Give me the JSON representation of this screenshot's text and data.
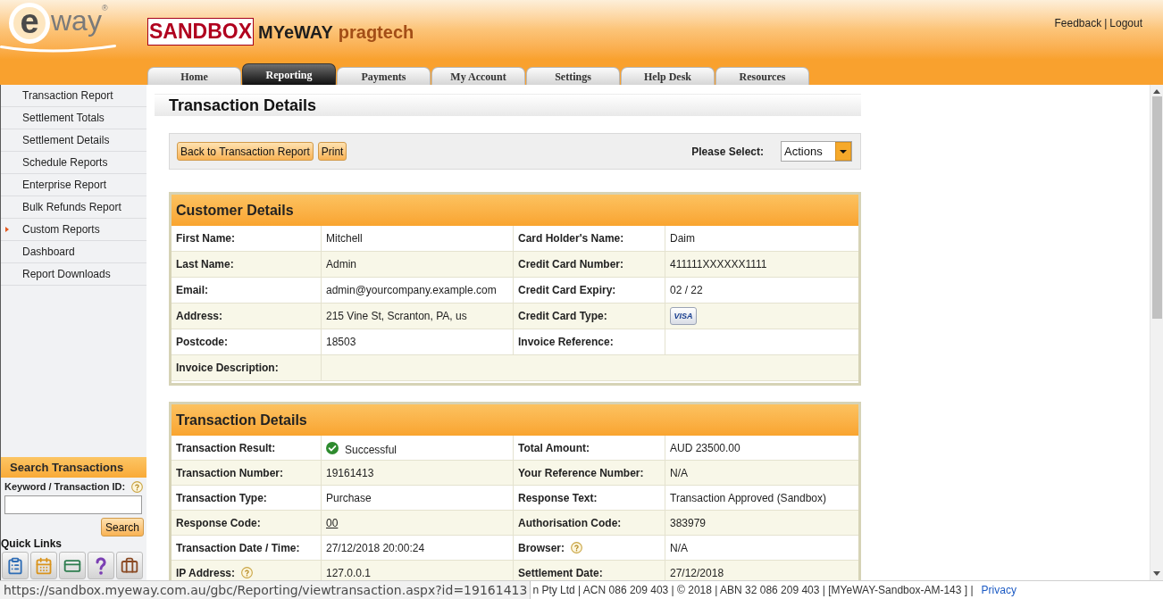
{
  "header": {
    "logo": {
      "mark": "e",
      "wordmark": "way$^{®}$"
    },
    "environment_badge": "SANDBOX",
    "app_name": "MYeWAY",
    "account_name": "pragtech",
    "links": [
      {
        "label": "Feedback"
      },
      {
        "label": "Logout"
      }
    ],
    "link_separator": "|"
  },
  "tabs": [
    {
      "label": "Home",
      "selected": false
    },
    {
      "label": "Reporting",
      "selected": true
    },
    {
      "label": "Payments",
      "selected": false
    },
    {
      "label": "My Account",
      "selected": false
    },
    {
      "label": "Settings",
      "selected": false
    },
    {
      "label": "Help Desk",
      "selected": false
    },
    {
      "label": "Resources",
      "selected": false
    }
  ],
  "sidebar": {
    "items": [
      {
        "label": "Transaction Report",
        "has_submenu": false
      },
      {
        "label": "Settlement Totals",
        "has_submenu": false
      },
      {
        "label": "Settlement Details",
        "has_submenu": false
      },
      {
        "label": "Schedule Reports",
        "has_submenu": false
      },
      {
        "label": "Enterprise Report",
        "has_submenu": false
      },
      {
        "label": "Bulk Refunds Report",
        "has_submenu": false
      },
      {
        "label": "Custom Reports",
        "has_submenu": true
      },
      {
        "label": "Dashboard",
        "has_submenu": false
      },
      {
        "label": "Report Downloads",
        "has_submenu": false
      }
    ],
    "search": {
      "title": "Search Transactions",
      "label": "Keyword / Transaction ID:",
      "button": "Search"
    },
    "quick_links": {
      "title": "Quick Links"
    }
  },
  "page": {
    "title": "Transaction Details",
    "toolbar": {
      "buttons": [
        "Back to Transaction Report",
        "Print"
      ],
      "select_label": "Please Select:",
      "select_value": "Actions"
    }
  },
  "sections": [
    {
      "title": "Customer Details",
      "rows": [
        [
          {
            "kind": "label",
            "text": "First Name:"
          },
          {
            "kind": "text",
            "text": "Mitchell"
          },
          {
            "kind": "label",
            "text": "Card Holder's Name:"
          },
          {
            "kind": "text",
            "text": "Daim"
          }
        ],
        [
          {
            "kind": "label",
            "text": "Last Name:"
          },
          {
            "kind": "text",
            "text": "Admin"
          },
          {
            "kind": "label",
            "text": "Credit Card Number:"
          },
          {
            "kind": "text",
            "text": "411111XXXXXX1111"
          }
        ],
        [
          {
            "kind": "label",
            "text": "Email:"
          },
          {
            "kind": "text",
            "text": "admin@yourcompany.example.com"
          },
          {
            "kind": "label",
            "text": "Credit Card Expiry:"
          },
          {
            "kind": "text",
            "text": "02 / 22"
          }
        ],
        [
          {
            "kind": "label",
            "text": "Address:"
          },
          {
            "kind": "text",
            "text": "215 Vine St, Scranton, PA, us"
          },
          {
            "kind": "label",
            "text": "Credit Card Type:"
          },
          {
            "kind": "card_logo",
            "text": "VISA"
          }
        ],
        [
          {
            "kind": "label",
            "text": "Postcode:"
          },
          {
            "kind": "text",
            "text": "18503"
          },
          {
            "kind": "label",
            "text": "Invoice Reference:"
          },
          {
            "kind": "blank"
          }
        ],
        [
          {
            "kind": "label",
            "text": "Invoice Description:"
          },
          {
            "kind": "blank"
          }
        ]
      ]
    },
    {
      "title": "Transaction Details",
      "rows": [
        [
          {
            "kind": "label",
            "text": "Transaction Result:"
          },
          {
            "kind": "status_success",
            "text": "Successful"
          },
          {
            "kind": "label",
            "text": "Total Amount:"
          },
          {
            "kind": "text",
            "text": "AUD 23500.00"
          }
        ],
        [
          {
            "kind": "label",
            "text": "Transaction Number:"
          },
          {
            "kind": "text",
            "text": "19161413"
          },
          {
            "kind": "label",
            "text": "Your Reference Number:"
          },
          {
            "kind": "text",
            "text": "N/A"
          }
        ],
        [
          {
            "kind": "label",
            "text": "Transaction Type:"
          },
          {
            "kind": "text",
            "text": "Purchase"
          },
          {
            "kind": "label",
            "text": "Response Text:"
          },
          {
            "kind": "text",
            "text": "Transaction Approved (Sandbox)"
          }
        ],
        [
          {
            "kind": "label",
            "text": "Response Code:"
          },
          {
            "kind": "link",
            "text": "00"
          },
          {
            "kind": "label",
            "text": "Authorisation Code:"
          },
          {
            "kind": "text",
            "text": "383979"
          }
        ],
        [
          {
            "kind": "label",
            "text": "Transaction Date / Time:"
          },
          {
            "kind": "text",
            "text": "27/12/2018 20:00:24"
          },
          {
            "kind": "label_help",
            "text": "Browser:"
          },
          {
            "kind": "text",
            "text": "N/A"
          }
        ],
        [
          {
            "kind": "label_help",
            "text": "IP Address:"
          },
          {
            "kind": "text",
            "text": "127.0.0.1"
          },
          {
            "kind": "label",
            "text": "Settlement Date:"
          },
          {
            "kind": "text",
            "text": "27/12/2018"
          }
        ]
      ]
    }
  ],
  "status_bar": {
    "url": "https://sandbox.myeway.com.au/gbc/Reporting/viewtransaction.aspx?id=19161413",
    "footer_text": "n Pty Ltd | ACN 086 209 403 | © 2018 | ABN 32 086 209 403 | [MYeWAY-Sandbox-AM-143 ] |",
    "footer_link": "Privacy"
  }
}
